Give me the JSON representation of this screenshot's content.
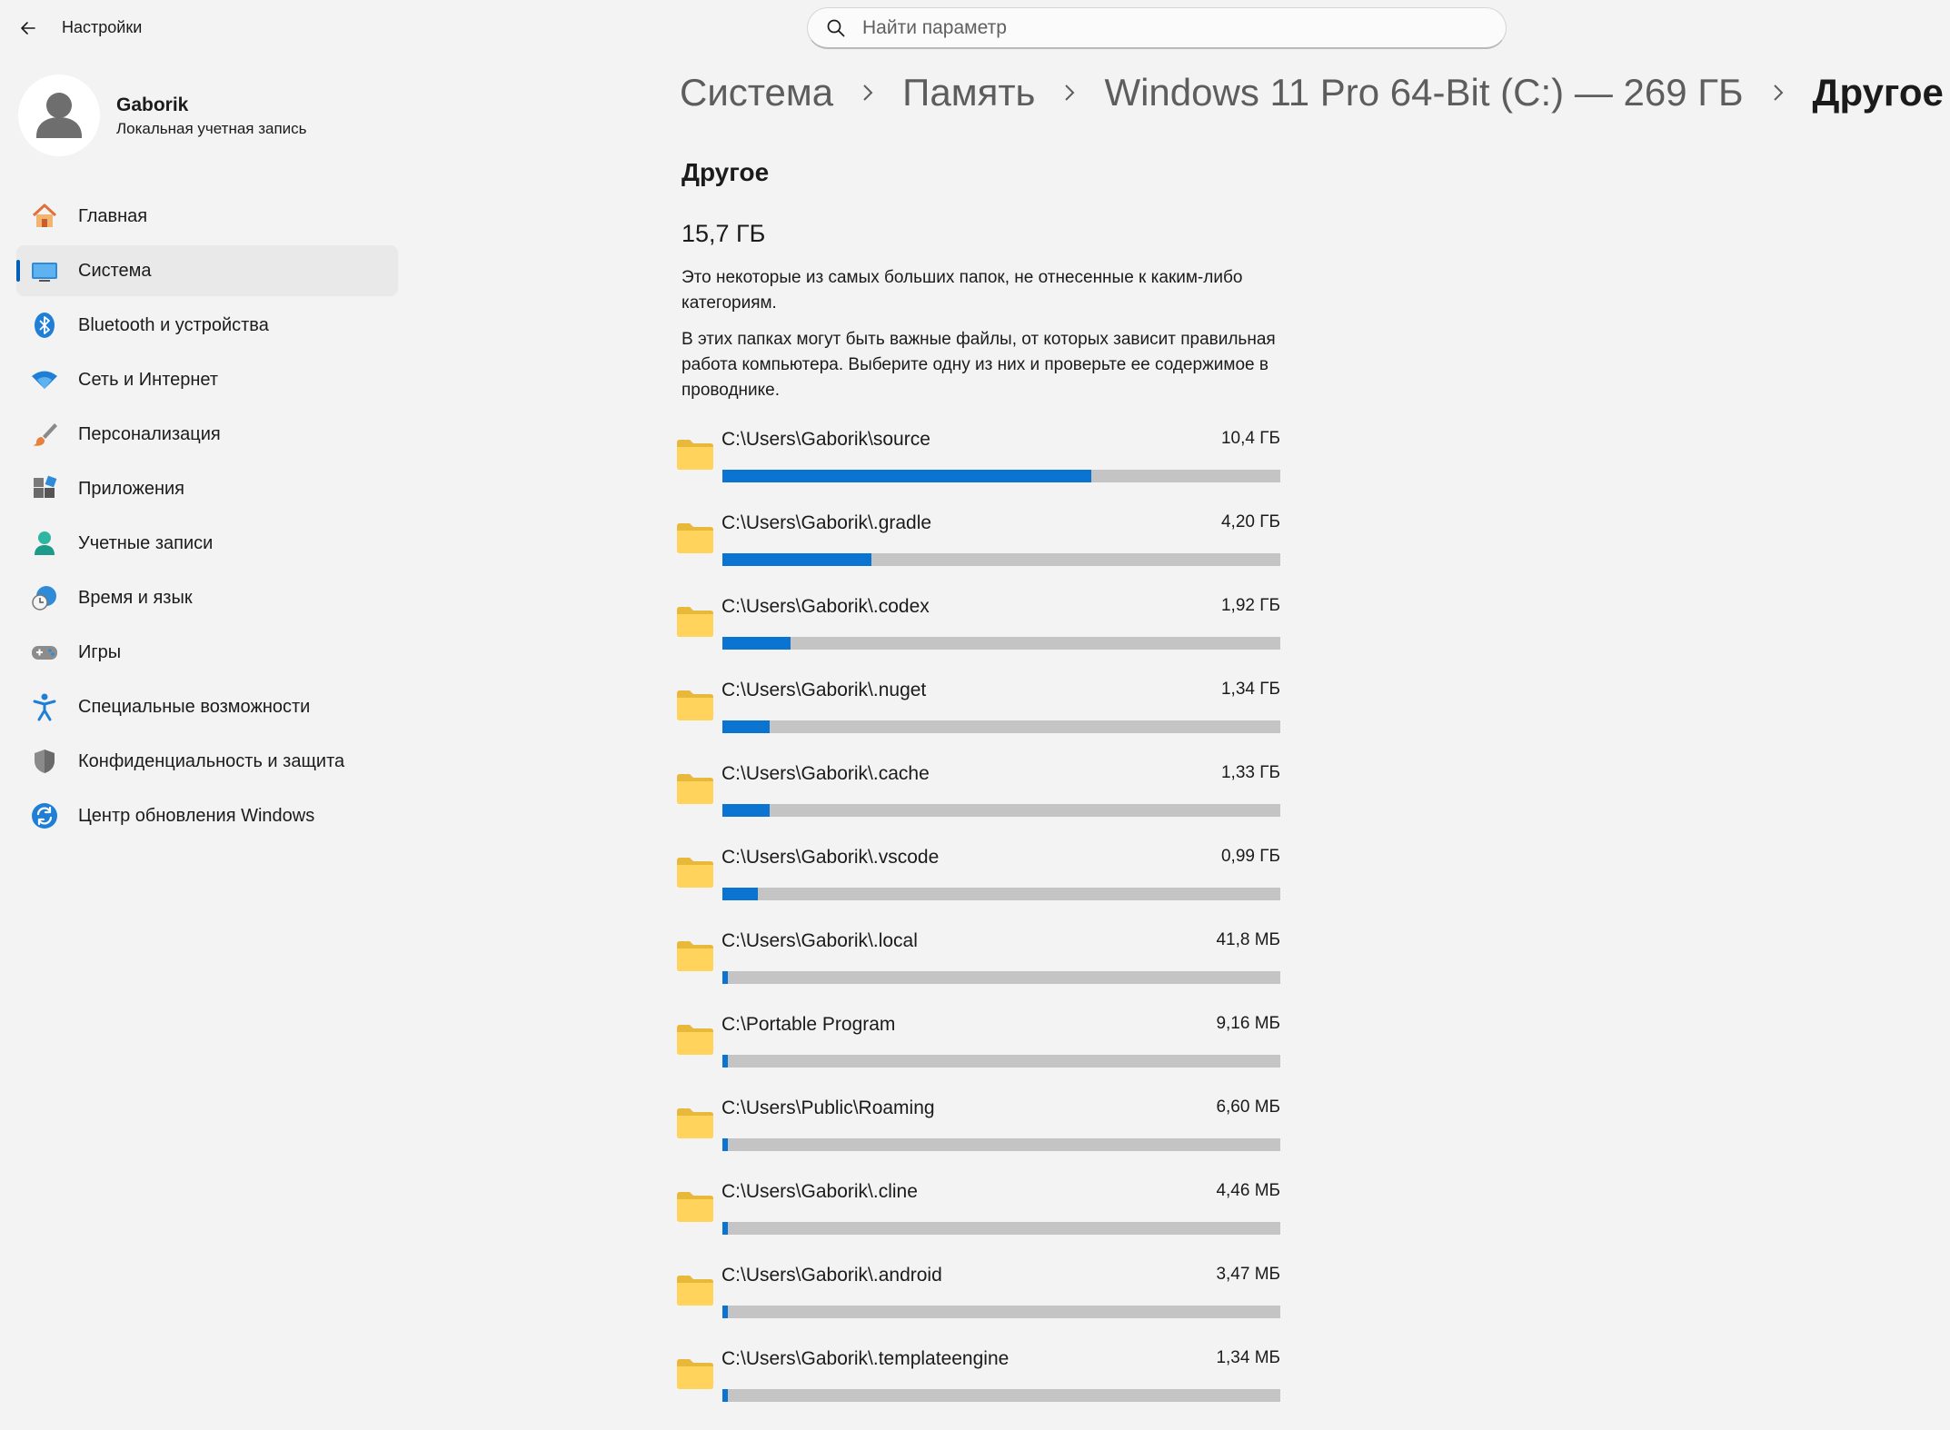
{
  "window": {
    "title": "Настройки",
    "search_placeholder": "Найти параметр"
  },
  "profile": {
    "name": "Gaborik",
    "account_type": "Локальная учетная запись"
  },
  "nav": [
    {
      "label": "Главная",
      "icon": "home-icon",
      "active": false
    },
    {
      "label": "Система",
      "icon": "system-icon",
      "active": true
    },
    {
      "label": "Bluetooth и устройства",
      "icon": "bluetooth-icon",
      "active": false
    },
    {
      "label": "Сеть и Интернет",
      "icon": "wifi-icon",
      "active": false
    },
    {
      "label": "Персонализация",
      "icon": "brush-icon",
      "active": false
    },
    {
      "label": "Приложения",
      "icon": "apps-icon",
      "active": false
    },
    {
      "label": "Учетные записи",
      "icon": "accounts-icon",
      "active": false
    },
    {
      "label": "Время и язык",
      "icon": "time-language-icon",
      "active": false
    },
    {
      "label": "Игры",
      "icon": "gamepad-icon",
      "active": false
    },
    {
      "label": "Специальные возможности",
      "icon": "accessibility-icon",
      "active": false
    },
    {
      "label": "Конфиденциальность и защита",
      "icon": "shield-icon",
      "active": false
    },
    {
      "label": "Центр обновления Windows",
      "icon": "update-icon",
      "active": false
    }
  ],
  "breadcrumb": {
    "items": [
      "Система",
      "Память",
      "Windows 11 Pro 64-Bit (C:) — 269 ГБ"
    ],
    "current": "Другое"
  },
  "content": {
    "title": "Другое",
    "total": "15,7 ГБ",
    "description_1": "Это некоторые из самых больших папок, не отнесенные к каким-либо категориям.",
    "description_2": "В этих папках могут быть важные файлы, от которых зависит правильная работа компьютера. Выберите одну из них и проверьте ее содержимое в проводнике."
  },
  "folders": [
    {
      "path": "C:\\Users\\Gaborik\\source",
      "size": "10,4 ГБ",
      "fill_fraction": 0.661
    },
    {
      "path": "C:\\Users\\Gaborik\\.gradle",
      "size": "4,20 ГБ",
      "fill_fraction": 0.267
    },
    {
      "path": "C:\\Users\\Gaborik\\.codex",
      "size": "1,92 ГБ",
      "fill_fraction": 0.122
    },
    {
      "path": "C:\\Users\\Gaborik\\.nuget",
      "size": "1,34 ГБ",
      "fill_fraction": 0.085
    },
    {
      "path": "C:\\Users\\Gaborik\\.cache",
      "size": "1,33 ГБ",
      "fill_fraction": 0.085
    },
    {
      "path": "C:\\Users\\Gaborik\\.vscode",
      "size": "0,99 ГБ",
      "fill_fraction": 0.063
    },
    {
      "path": "C:\\Users\\Gaborik\\.local",
      "size": "41,8 МБ",
      "fill_fraction": 0.01
    },
    {
      "path": "C:\\Portable Program",
      "size": "9,16 МБ",
      "fill_fraction": 0.01
    },
    {
      "path": "C:\\Users\\Public\\Roaming",
      "size": "6,60 МБ",
      "fill_fraction": 0.01
    },
    {
      "path": "C:\\Users\\Gaborik\\.cline",
      "size": "4,46 МБ",
      "fill_fraction": 0.01
    },
    {
      "path": "C:\\Users\\Gaborik\\.android",
      "size": "3,47 МБ",
      "fill_fraction": 0.01
    },
    {
      "path": "C:\\Users\\Gaborik\\.templateengine",
      "size": "1,34 МБ",
      "fill_fraction": 0.01
    }
  ],
  "colors": {
    "accent": "#005fb8",
    "bar_fill": "#0a74d0",
    "bar_track": "#c4c4c4",
    "background": "#f3f3f3"
  }
}
